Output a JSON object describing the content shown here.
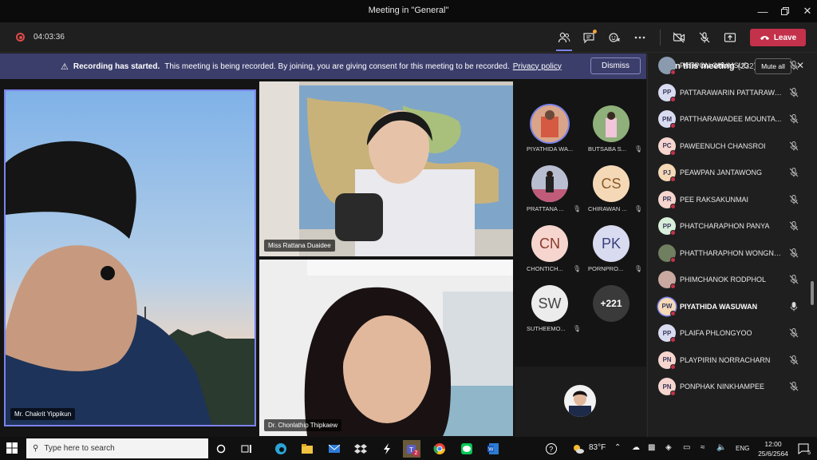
{
  "window": {
    "title": "Meeting in \"General\""
  },
  "controls": {
    "timer": "04:03:36",
    "leave_label": "Leave"
  },
  "banner": {
    "heading": "Recording has started.",
    "message": "This meeting is being recorded. By joining, you are giving consent for this meeting to be recorded.",
    "policy_link": "Privacy policy",
    "dismiss_label": "Dismiss"
  },
  "stage": {
    "main_name": "Mr. Chakrit Yippikun",
    "top_name": "Miss Rattana Duaidee",
    "bottom_name": "Dr. Chonlathip Thipkaew"
  },
  "grid": {
    "participants": [
      {
        "name": "PIYATHIDA WA...",
        "initials": "",
        "color": "#c0835f"
      },
      {
        "name": "BUTSABA S...",
        "initials": "",
        "color": "#6c8f5a"
      },
      {
        "name": "PRATTANA ...",
        "initials": "",
        "color": "#9aa0b5"
      },
      {
        "name": "CHIRAWAN ...",
        "initials": "CS",
        "color": "#f5d9b7"
      },
      {
        "name": "CHONTICH...",
        "initials": "CN",
        "color": "#f6d5cf"
      },
      {
        "name": "PORNPRO...",
        "initials": "PK",
        "color": "#d9dbf1"
      },
      {
        "name": "SUTHEEMO...",
        "initials": "SW",
        "color": "#ececec"
      }
    ],
    "overflow": "+221"
  },
  "panel": {
    "title": "In this meeting",
    "count": "(232)",
    "mute_all": "Mute all",
    "people": [
      {
        "name": "PATIPON CHUMSUD",
        "initials": "",
        "color": "#8a9bb0",
        "bold": false,
        "speaking": false
      },
      {
        "name": "PATTARAWARIN PATTARAWA...",
        "initials": "PP",
        "color": "#d9dbf1",
        "bold": false,
        "speaking": false
      },
      {
        "name": "PATTHARAWADEE MOUNTA...",
        "initials": "PM",
        "color": "#d9dbf1",
        "bold": false,
        "speaking": false
      },
      {
        "name": "PAWEENUCH CHANSROI",
        "initials": "PC",
        "color": "#f6d5cf",
        "bold": false,
        "speaking": false
      },
      {
        "name": "PEAWPAN JANTAWONG",
        "initials": "PJ",
        "color": "#f5d9b7",
        "bold": false,
        "speaking": false
      },
      {
        "name": "PEE RAKSAKUNMAI",
        "initials": "PR",
        "color": "#f6d5cf",
        "bold": false,
        "speaking": false
      },
      {
        "name": "PHATCHARAPHON PANYA",
        "initials": "PP",
        "color": "#d7efd9",
        "bold": false,
        "speaking": false
      },
      {
        "name": "PHATTHARAPHON WONGNEN",
        "initials": "",
        "color": "#6f7f5f",
        "bold": false,
        "speaking": false
      },
      {
        "name": "PHIMCHANOK RODPHOL",
        "initials": "",
        "color": "#c9a9a0",
        "bold": false,
        "speaking": false
      },
      {
        "name": "PIYATHIDA WASUWAN",
        "initials": "PW",
        "color": "#f5d9b7",
        "bold": true,
        "speaking": true
      },
      {
        "name": "PLAIFA PHLONGYOO",
        "initials": "PP",
        "color": "#d9dbf1",
        "bold": false,
        "speaking": false
      },
      {
        "name": "PLAYPIRIN NORRACHARN",
        "initials": "PN",
        "color": "#f6d5cf",
        "bold": false,
        "speaking": false
      },
      {
        "name": "PONPHAK NINKHAMPEE",
        "initials": "PN",
        "color": "#f6d5cf",
        "bold": false,
        "speaking": false
      }
    ]
  },
  "taskbar": {
    "search_placeholder": "Type here to search",
    "weather": "83°F",
    "time": "12:00",
    "date": "25/6/2564",
    "lang": "ENG",
    "teams_badge": "2",
    "notif_count": "5"
  }
}
